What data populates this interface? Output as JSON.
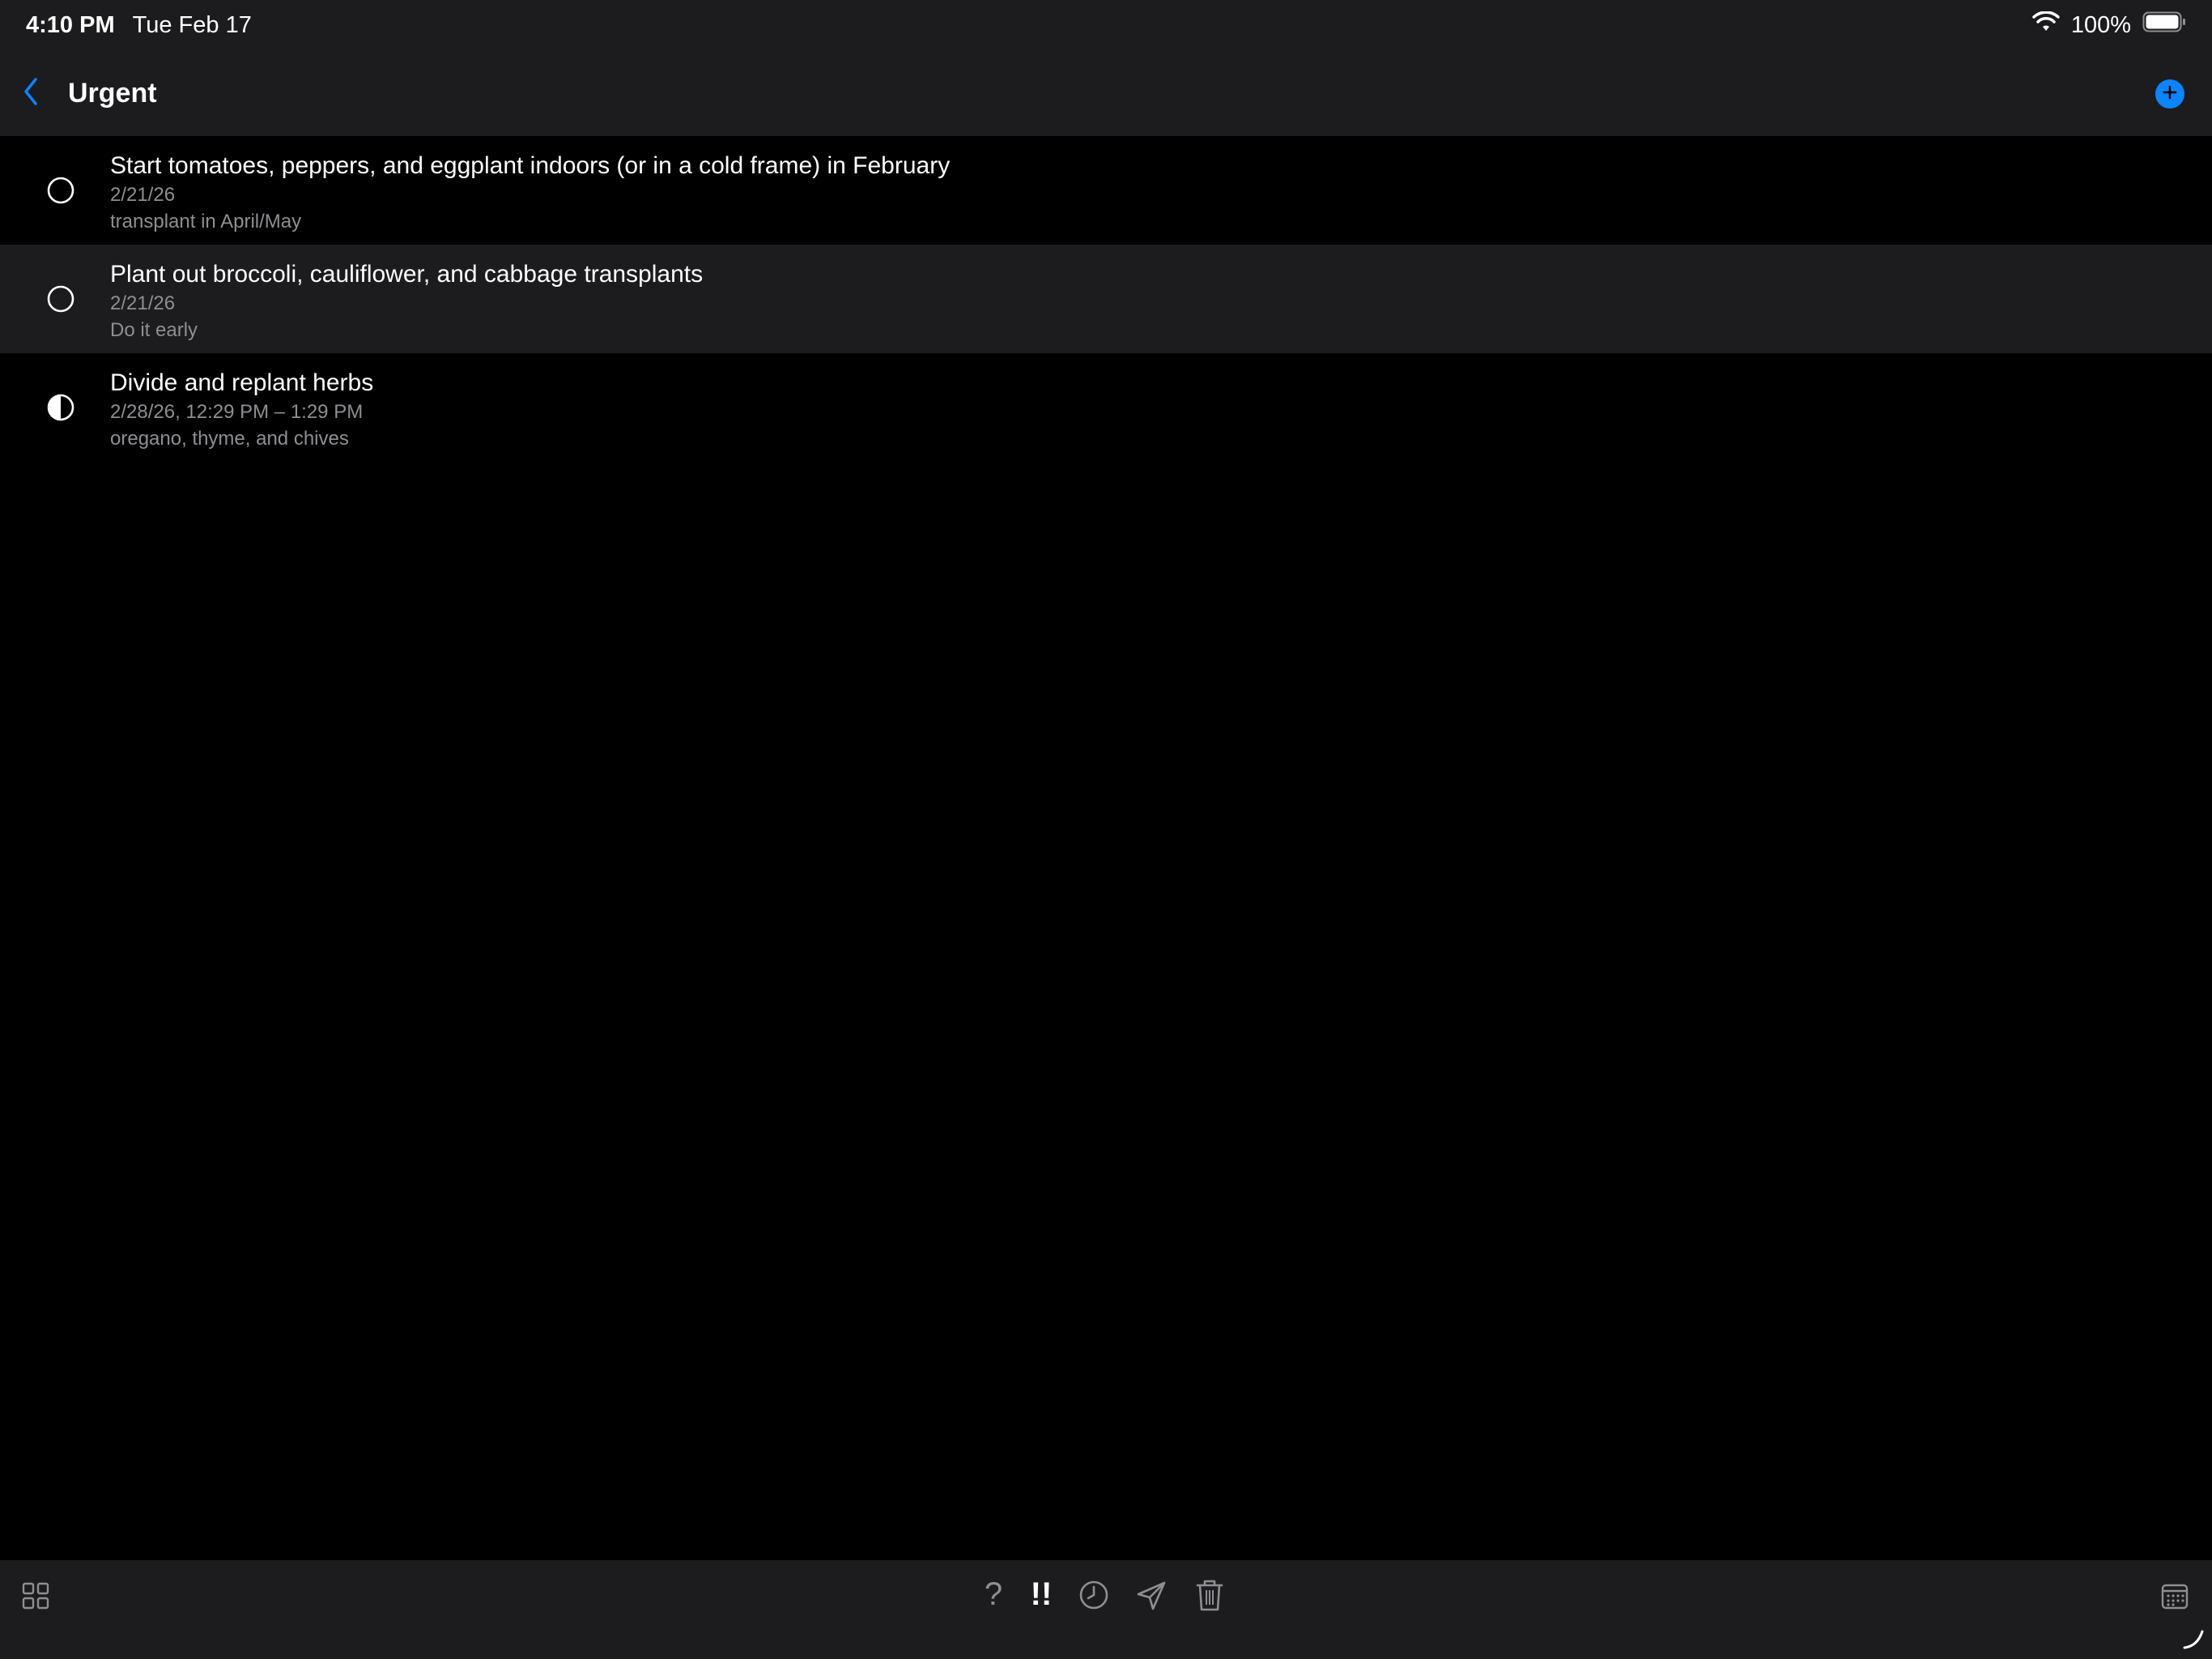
{
  "status_bar": {
    "time": "4:10 PM",
    "date": "Tue Feb 17",
    "battery_percent": "100%",
    "icons": [
      "wifi-icon",
      "battery-icon"
    ]
  },
  "nav": {
    "title": "Urgent",
    "back_icon": "chevron-left-icon",
    "add_icon": "plus-circle-icon",
    "accent_color": "#0a84ff"
  },
  "tasks": [
    {
      "title": "Start tomatoes, peppers, and eggplant indoors (or in a cold frame) in February",
      "date": "2/21/26",
      "note": "transplant in April/May",
      "status": "empty-circle",
      "selected": false
    },
    {
      "title": "Plant out broccoli, cauliflower, and cabbage transplants",
      "date": "2/21/26",
      "note": "Do it early",
      "status": "empty-circle",
      "selected": true
    },
    {
      "title": "Divide and replant herbs",
      "date": "2/28/26, 12:29 PM – 1:29 PM",
      "note": "oregano, thyme, and chives",
      "status": "half-filled-circle",
      "selected": false
    }
  ],
  "toolbar": {
    "question_label": "?",
    "priority_label": "!!",
    "icons": [
      "grid-icon",
      "question-icon",
      "priority-icon",
      "clock-icon",
      "send-icon",
      "trash-icon",
      "calendar-icon"
    ]
  }
}
